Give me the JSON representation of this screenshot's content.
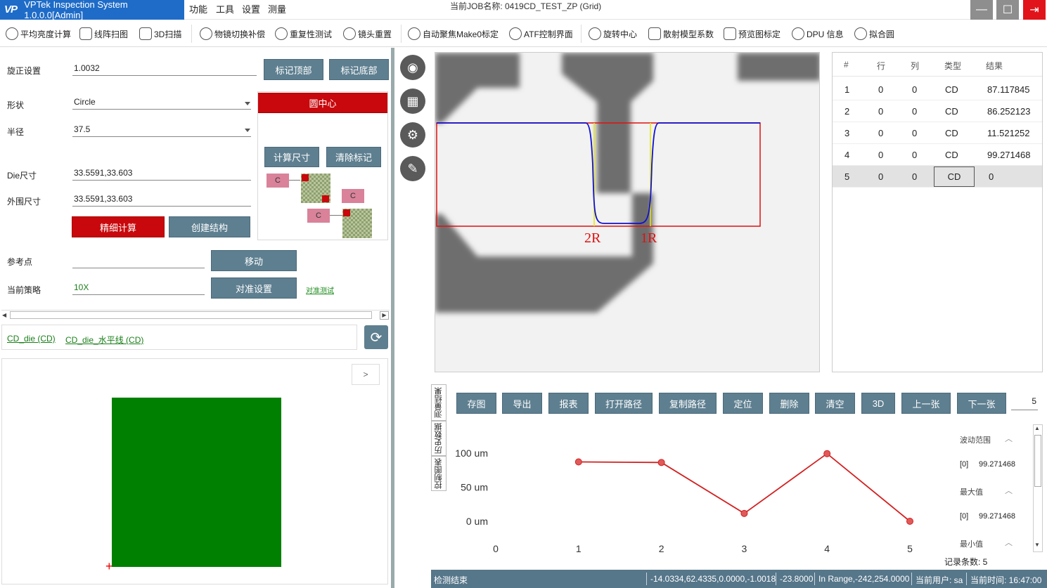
{
  "app": {
    "title": "VPTek Inspection System 1.0.0.0[Admin]",
    "logo": "VP",
    "job_label": "当前JOB名称:  0419CD_TEST_ZP (Grid)"
  },
  "menu": [
    "功能",
    "工具",
    "设置",
    "测量"
  ],
  "window_controls": {
    "minimize": "—",
    "maximize": "☐",
    "exit": "⇥"
  },
  "toolbar": [
    {
      "label": "平均亮度计算",
      "icon": "bulb-icon"
    },
    {
      "label": "线阵扫图",
      "icon": "line-scan-icon"
    },
    {
      "label": "3D扫描",
      "icon": "3d-scan-icon"
    },
    {
      "label": "物镜切换补偿",
      "icon": "objective-switch-icon"
    },
    {
      "label": "重复性测试",
      "icon": "repeat-test-icon"
    },
    {
      "label": "镜头重置",
      "icon": "lens-reset-icon"
    },
    {
      "label": "自动聚焦Make0标定",
      "icon": "crosshair-icon"
    },
    {
      "label": "ATF控制界面",
      "icon": "crosshair-icon"
    },
    {
      "label": "旋转中心",
      "icon": "rotation-center-icon"
    },
    {
      "label": "散射模型系数",
      "icon": "scatter-curve-icon"
    },
    {
      "label": "预览图标定",
      "icon": "preview-calibrate-icon"
    },
    {
      "label": "DPU 信息",
      "icon": "gear-icon"
    },
    {
      "label": "拟合圆",
      "icon": "circle-icon"
    }
  ],
  "settings": {
    "rotation_label": "旋正设置",
    "rotation_value": "1.0032",
    "mark_top": "标记顶部",
    "mark_bottom": "标记底部",
    "shape_label": "形状",
    "shape_value": "Circle",
    "circle_center": "圆中心",
    "radius_label": "半径",
    "radius_value": "37.5",
    "calc_size": "计算尺寸",
    "clear_marks": "清除标记",
    "die_size_label": "Die尺寸",
    "die_size_value": "33.5591,33.603",
    "outer_size_label": "外围尺寸",
    "outer_size_value": "33.5591,33.603",
    "fine_calc": "精细计算",
    "create_struct": "创建结构",
    "ref_point_label": "参考点",
    "ref_point_value": "",
    "move": "移动",
    "strategy_label": "当前策略",
    "strategy_value": "10X",
    "align_settings": "对准设置",
    "align_test": "对准测试",
    "struct_block_label": "C"
  },
  "recipes": [
    "CD_die (CD)",
    "CD_die_水平线 (CD)"
  ],
  "preview": {
    "expand": ">"
  },
  "image_view": {
    "label_left": "2R",
    "label_right": "1R"
  },
  "results": {
    "headers": [
      "#",
      "行",
      "列",
      "类型",
      "结果"
    ],
    "rows": [
      [
        "1",
        "0",
        "0",
        "CD",
        "87.117845"
      ],
      [
        "2",
        "0",
        "0",
        "CD",
        "86.252123"
      ],
      [
        "3",
        "0",
        "0",
        "CD",
        "11.521252"
      ],
      [
        "4",
        "0",
        "0",
        "CD",
        "99.271468"
      ],
      [
        "5",
        "0",
        "0",
        "CD",
        "0"
      ]
    ]
  },
  "bottom_tabs": [
    "测量结果",
    "历史数据",
    "控制图表"
  ],
  "actions": [
    "存图",
    "导出",
    "报表",
    "打开路径",
    "复制路径",
    "定位",
    "删除",
    "清空",
    "3D",
    "上一张",
    "下一张"
  ],
  "page_number": "5",
  "chart_data": {
    "type": "line",
    "x": [
      1,
      2,
      3,
      4,
      5
    ],
    "values": [
      87.117845,
      86.252123,
      11.521252,
      99.271468,
      0
    ],
    "xticks": [
      "0",
      "1",
      "2",
      "3",
      "4",
      "5"
    ],
    "yticks": [
      "100 um",
      "50 um",
      "0 um"
    ],
    "xlim": [
      0,
      5
    ],
    "ylim": [
      0,
      100
    ],
    "color": "#d42020"
  },
  "stats": {
    "range_label": "波动范围",
    "range_value": "99.271468",
    "max_label": "最大值",
    "max_value": "99.271468",
    "min_label": "最小值",
    "index_label": "[0]"
  },
  "records": "记录条数: 5",
  "status": {
    "state": "检测结束",
    "coords": "-14.0334,62.4335,0.0000,-1.0018",
    "z": "-23.8000",
    "range": "In Range,-242,254.0000",
    "user": "当前用户:  sa",
    "time": "当前时间:  16:47:00"
  },
  "colors": {
    "accent": "#1e6cc8",
    "button": "#5e7f90",
    "danger": "#c8080c",
    "die": "#008000"
  }
}
